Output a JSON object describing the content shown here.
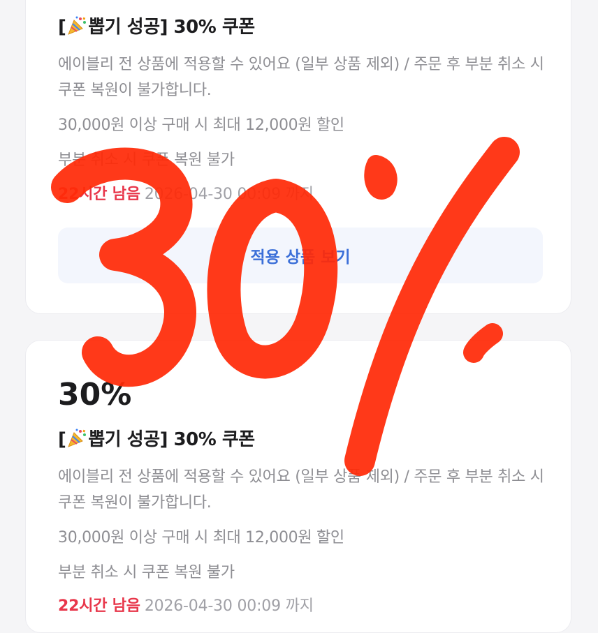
{
  "coupons": [
    {
      "percent": "",
      "title_prefix": "[",
      "title_suffix": "뽑기 성공] 30% 쿠폰",
      "description": "에이블리 전 상품에 적용할 수 있어요 (일부 상품 제외) / 주문 후 부분 취소 시 쿠폰 복원이 불가합니다.",
      "condition": "30,000원 이상 구매 시 최대 12,000원 할인",
      "cancel_note": "부분 취소 시 쿠폰 복원 불가",
      "remaining": "22시간 남음",
      "expiry": "2026-04-30 00:09 까지",
      "apply_label": "적용 상품 보기"
    },
    {
      "percent": "30%",
      "title_prefix": "[",
      "title_suffix": "뽑기 성공] 30% 쿠폰",
      "description": "에이블리 전 상품에 적용할 수 있어요 (일부 상품 제외) / 주문 후 부분 취소 시 쿠폰 복원이 불가합니다.",
      "condition": "30,000원 이상 구매 시 최대 12,000원 할인",
      "cancel_note": "부분 취소 시 쿠폰 복원 불가",
      "remaining": "22시간 남음",
      "expiry": "2026-04-30 00:09 까지"
    }
  ],
  "overlay": {
    "text": "30%",
    "color": "#ff2a08"
  },
  "colors": {
    "accent_blue": "#3b6fd8",
    "danger_red": "#e8364a",
    "muted_text": "#8e8e93"
  },
  "icons": {
    "party": "party-popper-icon"
  }
}
